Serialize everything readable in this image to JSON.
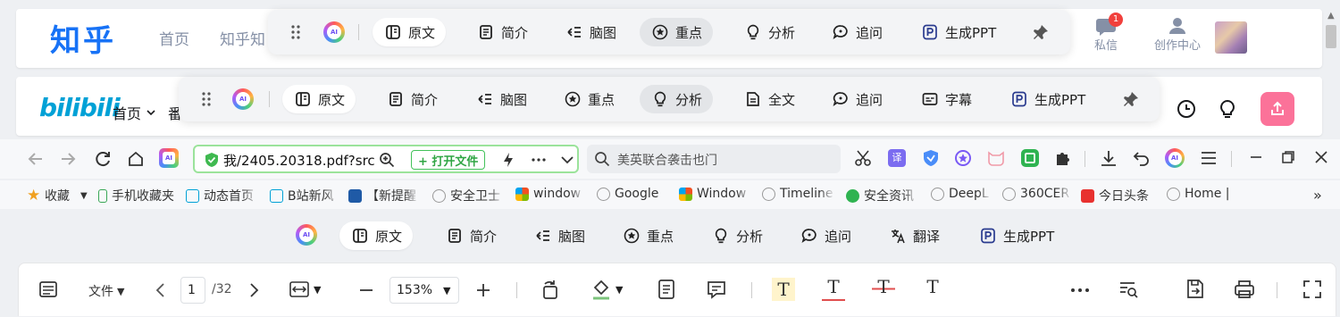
{
  "zhihu": {
    "logo": "知乎",
    "nav": [
      "首页",
      "知乎知"
    ],
    "messages_label": "私信",
    "messages_badge": "1",
    "creator_label": "创作中心"
  },
  "toolbar_top": {
    "items": [
      "原文",
      "简介",
      "脑图",
      "重点",
      "分析",
      "追问",
      "生成PPT"
    ]
  },
  "bilibili": {
    "logo": "bilibili",
    "home_label": "首页",
    "fan_label": "番"
  },
  "toolbar_mid": {
    "items": [
      "原文",
      "简介",
      "脑图",
      "重点",
      "分析",
      "全文",
      "追问",
      "字幕",
      "生成PPT"
    ]
  },
  "browser": {
    "address": "我/2405.20318.pdf?src",
    "open_file": "+ 打开文件",
    "search_placeholder": "美英联合袭击也门"
  },
  "bookmarks": {
    "items": [
      "收藏",
      "手机收藏夹",
      "动态首页",
      "B站新风",
      "【新提醒",
      "安全卫士",
      "window",
      "Google",
      "Window",
      "Timeline",
      "安全资讯",
      "DeepL",
      "360CER",
      "今日头条",
      "Home |"
    ]
  },
  "pdf_ai": {
    "items": [
      "原文",
      "简介",
      "脑图",
      "重点",
      "分析",
      "追问",
      "翻译",
      "生成PPT"
    ]
  },
  "pdf_toolbar": {
    "file_menu": "文件",
    "page_current": "1",
    "page_total": "/32",
    "zoom": "153%"
  },
  "colors": {
    "zhihu_blue": "#1772f6",
    "bili_blue": "#00a1d6",
    "bili_pink": "#fb7299",
    "green_border": "#9be39b"
  }
}
